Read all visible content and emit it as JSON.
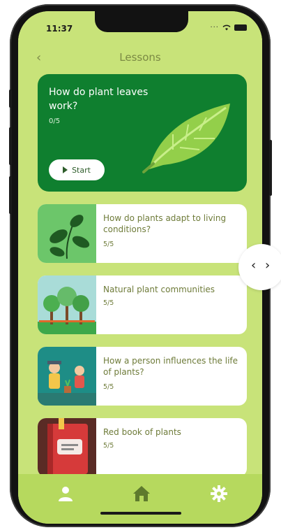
{
  "status": {
    "time": "11:37"
  },
  "header": {
    "title": "Lessons"
  },
  "featured": {
    "title": "How do plant leaves work?",
    "progress": "0/5",
    "start_label": "Start"
  },
  "lessons": [
    {
      "title": "How do plants adapt to living conditions?",
      "progress": "5/5",
      "thumb_color": "#6cc66a"
    },
    {
      "title": "Natural plant communities",
      "progress": "5/5",
      "thumb_color": "#a9dcd8"
    },
    {
      "title": "How a person influences the life of plants?",
      "progress": "5/5",
      "thumb_color": "#1e8d86"
    },
    {
      "title": "Red book of plants",
      "progress": "5/5",
      "thumb_color": "#5a2b25"
    }
  ],
  "tabbar": {
    "items": [
      "person-icon",
      "home-icon",
      "gear-icon"
    ]
  },
  "colors": {
    "accent": "#c8e379",
    "featured": "#0f7f2f",
    "text": "#6e7b39"
  }
}
